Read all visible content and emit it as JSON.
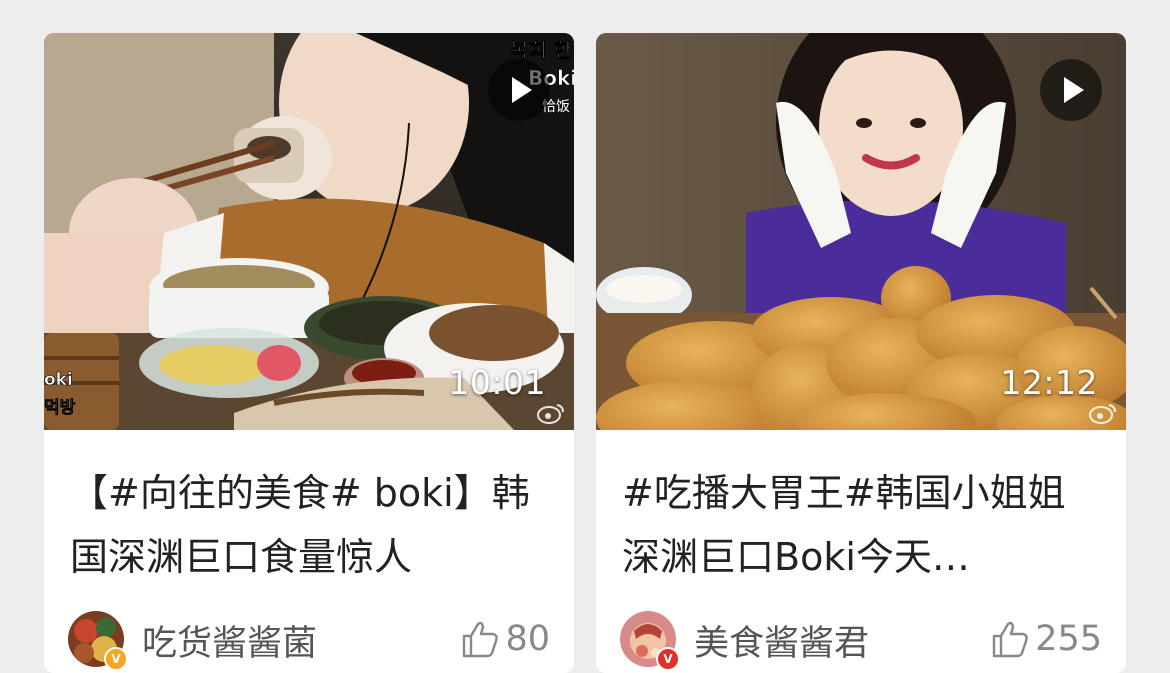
{
  "colors": {
    "background": "#ededed",
    "card": "#ffffff",
    "title_text": "#222222",
    "meta_text": "#888888",
    "verified_badge": "#f5a623"
  },
  "cards": [
    {
      "title": "【#向往的美食# boki】韩国深渊巨口食量惊人",
      "title_visible": "【#向往的美食# boki】韩国深渊巨口食量惊…",
      "duration": "10:01",
      "author": "吃货酱酱菌",
      "likes": "80",
      "thumbnail_caption": "복희 한 Boki 恰饭",
      "thumbnail_corner_caption": "oki 먹방",
      "icons": {
        "play": "play-icon",
        "like": "thumbs-up-icon",
        "watermark": "weibo-icon"
      }
    },
    {
      "title": "#吃播大胃王#韩国小姐姐深渊巨口Boki今天…",
      "title_visible": "#吃播大胃王#韩国小姐姐深渊巨口Boki今天…",
      "duration": "12:12",
      "author": "美食酱酱君",
      "likes": "255",
      "icons": {
        "play": "play-icon",
        "like": "thumbs-up-icon",
        "watermark": "weibo-icon"
      }
    }
  ]
}
